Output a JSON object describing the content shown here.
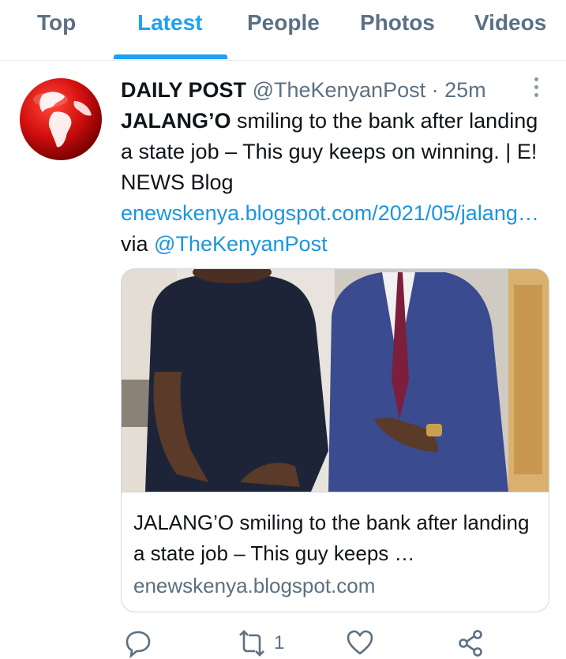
{
  "tabs": [
    {
      "label": "Top",
      "active": false
    },
    {
      "label": "Latest",
      "active": true
    },
    {
      "label": "People",
      "active": false
    },
    {
      "label": "Photos",
      "active": false
    },
    {
      "label": "Videos",
      "active": false
    }
  ],
  "tweet": {
    "author_name": "DAILY POST",
    "handle": "@TheKenyanPost",
    "separator": "·",
    "time": "25m",
    "text_bold": "JALANG’O",
    "text_rest": " smiling to the bank after landing a state job – This guy keeps on winning. | E! NEWS Blog",
    "link": "enewskenya.blogspot.com/2021/05/jalang…",
    "via_label": "via",
    "via_handle": "@TheKenyanPost",
    "card": {
      "title": "JALANG’O smiling to the bank after landing a state job – This guy keeps …",
      "domain": "enewskenya.blogspot.com"
    },
    "actions": {
      "retweet_count": "1"
    }
  },
  "colors": {
    "accent": "#1da1f2",
    "link": "#1b95e0",
    "muted": "#5b7083"
  },
  "icons": [
    "globe-avatar",
    "more-icon",
    "reply-icon",
    "retweet-icon",
    "like-icon",
    "share-icon"
  ]
}
